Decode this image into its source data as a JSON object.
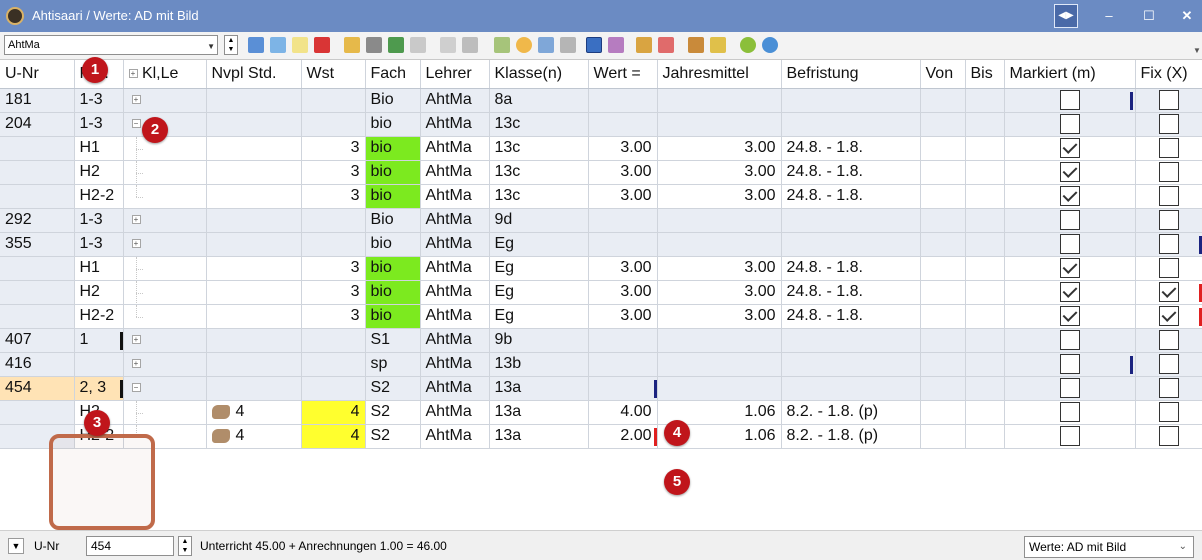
{
  "window": {
    "title": "Ahtisaari / Werte: AD mit Bild"
  },
  "toolbar": {
    "teacher_select": "AhtMa"
  },
  "columns": [
    "U-Nr",
    "Prd.",
    "Kl,Le",
    "Nvpl Std.",
    "Wst",
    "Fach",
    "Lehrer",
    "Klasse(n)",
    "Wert =",
    "Jahresmittel",
    "Befristung",
    "Von",
    "Bis",
    "Markiert (m)",
    "Fix (X)"
  ],
  "rows": [
    {
      "unr": "181",
      "prd": "1-3",
      "nvpl": "",
      "wst": "",
      "fach": "Bio",
      "lehrer": "AhtMa",
      "klasse": "8a",
      "wert": "",
      "jahres": "",
      "befr": ""
    },
    {
      "unr": "204",
      "prd": "1-3",
      "nvpl": "",
      "wst": "",
      "fach": "bio",
      "lehrer": "AhtMa",
      "klasse": "13c",
      "wert": "",
      "jahres": "",
      "befr": ""
    },
    {
      "unr": "",
      "prd": "H1",
      "nvpl": "",
      "wst": "3",
      "fach": "bio",
      "lehrer": "AhtMa",
      "klasse": "13c",
      "wert": "3.00",
      "jahres": "3.00",
      "befr": "24.8. - 1.8."
    },
    {
      "unr": "",
      "prd": "H2",
      "nvpl": "",
      "wst": "3",
      "fach": "bio",
      "lehrer": "AhtMa",
      "klasse": "13c",
      "wert": "3.00",
      "jahres": "3.00",
      "befr": "24.8. - 1.8."
    },
    {
      "unr": "",
      "prd": "H2-2",
      "nvpl": "",
      "wst": "3",
      "fach": "bio",
      "lehrer": "AhtMa",
      "klasse": "13c",
      "wert": "3.00",
      "jahres": "3.00",
      "befr": "24.8. - 1.8."
    },
    {
      "unr": "292",
      "prd": "1-3",
      "nvpl": "",
      "wst": "",
      "fach": "Bio",
      "lehrer": "AhtMa",
      "klasse": "9d",
      "wert": "",
      "jahres": "",
      "befr": ""
    },
    {
      "unr": "355",
      "prd": "1-3",
      "nvpl": "",
      "wst": "",
      "fach": "bio",
      "lehrer": "AhtMa",
      "klasse": "Eg",
      "wert": "",
      "jahres": "",
      "befr": ""
    },
    {
      "unr": "",
      "prd": "H1",
      "nvpl": "",
      "wst": "3",
      "fach": "bio",
      "lehrer": "AhtMa",
      "klasse": "Eg",
      "wert": "3.00",
      "jahres": "3.00",
      "befr": "24.8. - 1.8."
    },
    {
      "unr": "",
      "prd": "H2",
      "nvpl": "",
      "wst": "3",
      "fach": "bio",
      "lehrer": "AhtMa",
      "klasse": "Eg",
      "wert": "3.00",
      "jahres": "3.00",
      "befr": "24.8. - 1.8."
    },
    {
      "unr": "",
      "prd": "H2-2",
      "nvpl": "",
      "wst": "3",
      "fach": "bio",
      "lehrer": "AhtMa",
      "klasse": "Eg",
      "wert": "3.00",
      "jahres": "3.00",
      "befr": "24.8. - 1.8."
    },
    {
      "unr": "407",
      "prd": "1",
      "nvpl": "",
      "wst": "",
      "fach": "S1",
      "lehrer": "AhtMa",
      "klasse": "9b",
      "wert": "",
      "jahres": "",
      "befr": ""
    },
    {
      "unr": "416",
      "prd": "",
      "nvpl": "",
      "wst": "",
      "fach": "sp",
      "lehrer": "AhtMa",
      "klasse": "13b",
      "wert": "",
      "jahres": "",
      "befr": ""
    },
    {
      "unr": "454",
      "prd": "2, 3",
      "nvpl": "",
      "wst": "",
      "fach": "S2",
      "lehrer": "AhtMa",
      "klasse": "13a",
      "wert": "",
      "jahres": "",
      "befr": ""
    },
    {
      "unr": "",
      "prd": "H2",
      "nvpl": "4",
      "wst": "4",
      "fach": "S2",
      "lehrer": "AhtMa",
      "klasse": "13a",
      "wert": "4.00",
      "jahres": "1.06",
      "befr": "8.2. - 1.8. (p)"
    },
    {
      "unr": "",
      "prd": "H2-2",
      "nvpl": "4",
      "wst": "4",
      "fach": "S2",
      "lehrer": "AhtMa",
      "klasse": "13a",
      "wert": "2.00",
      "jahres": "1.06",
      "befr": "8.2. - 1.8. (p)"
    }
  ],
  "badges": [
    "1",
    "2",
    "3",
    "4",
    "5"
  ],
  "statusbar": {
    "unr_label": "U-Nr",
    "unr_value": "454",
    "summary": "Unterricht 45.00 + Anrechnungen 1.00 = 46.00",
    "view_select": "Werte: AD mit Bild"
  },
  "colors": {
    "title_bg": "#6b8bc3",
    "fach_green": "#7cea1f",
    "wst_yellow": "#ffff2e",
    "badge_red": "#c0151b",
    "selected_row": "#ffe3b5"
  }
}
